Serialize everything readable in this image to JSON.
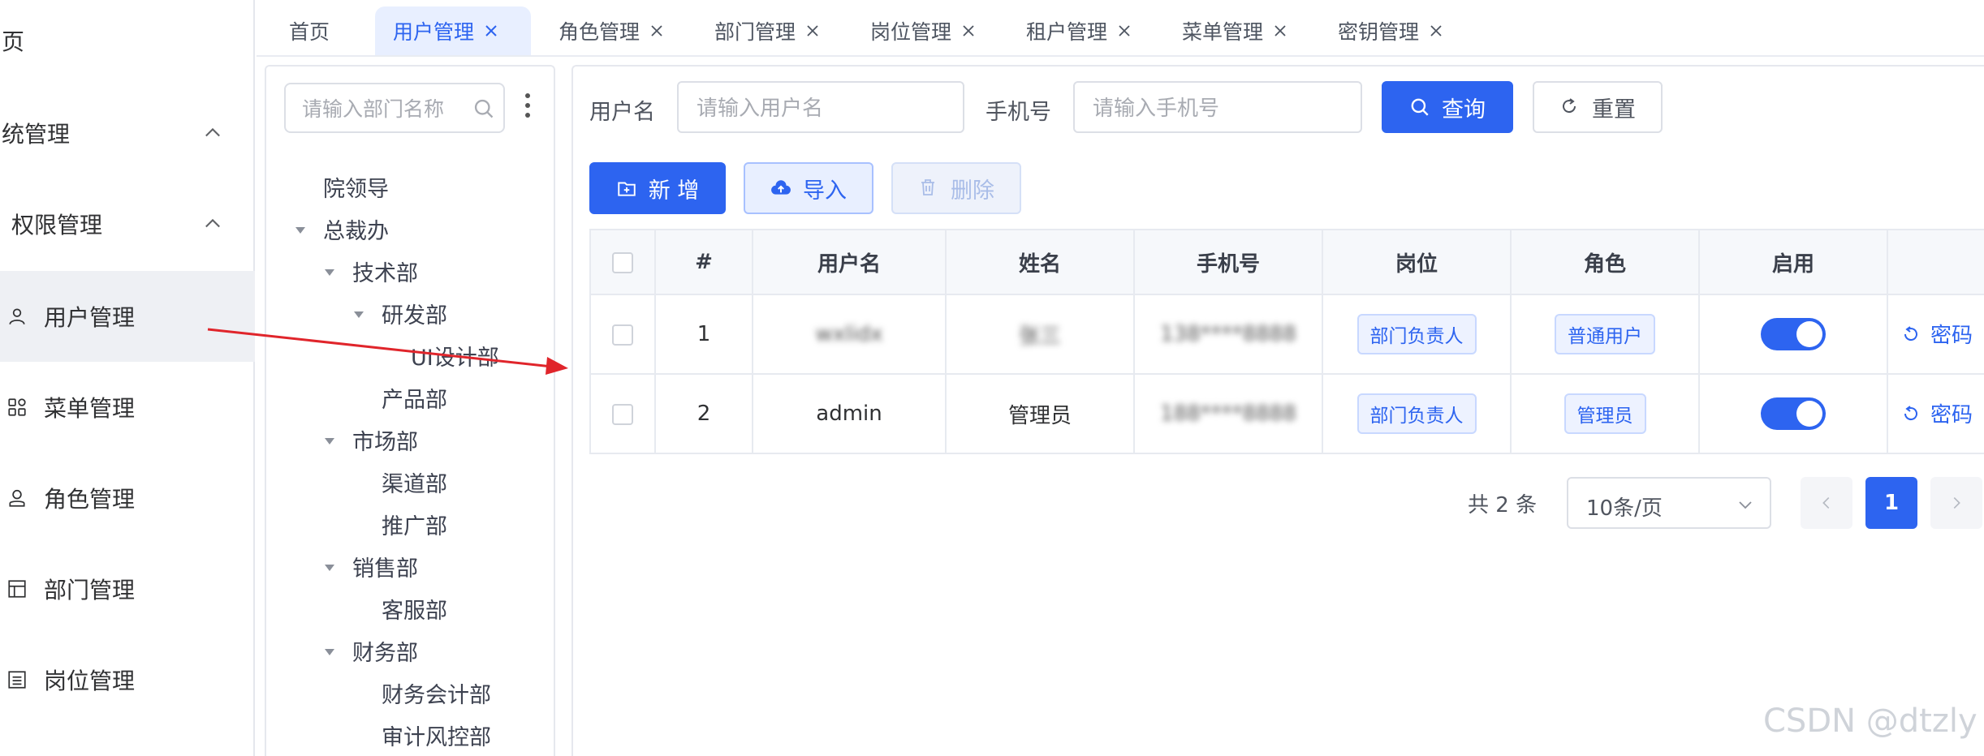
{
  "sidebar": {
    "items": [
      {
        "label": "页"
      },
      {
        "label": "统管理"
      },
      {
        "label": "权限管理"
      },
      {
        "label": "用户管理"
      },
      {
        "label": "菜单管理"
      },
      {
        "label": "角色管理"
      },
      {
        "label": "部门管理"
      },
      {
        "label": "岗位管理"
      }
    ]
  },
  "tabs": [
    {
      "label": "首页"
    },
    {
      "label": "用户管理"
    },
    {
      "label": "角色管理"
    },
    {
      "label": "部门管理"
    },
    {
      "label": "岗位管理"
    },
    {
      "label": "租户管理"
    },
    {
      "label": "菜单管理"
    },
    {
      "label": "密钥管理"
    }
  ],
  "dept": {
    "search_placeholder": "请输入部门名称",
    "tree": [
      "院领导",
      "总裁办",
      "技术部",
      "研发部",
      "UI设计部",
      "产品部",
      "市场部",
      "渠道部",
      "推广部",
      "销售部",
      "客服部",
      "财务部",
      "财务会计部",
      "审计风控部"
    ]
  },
  "filters": {
    "username_label": "用户名",
    "username_placeholder": "请输入用户名",
    "phone_label": "手机号",
    "phone_placeholder": "请输入手机号",
    "query_label": "查询",
    "reset_label": "重置"
  },
  "actions": {
    "add_label": "新 增",
    "import_label": "导入",
    "delete_label": "删除"
  },
  "table": {
    "headers": [
      "#",
      "用户名",
      "姓名",
      "手机号",
      "岗位",
      "角色",
      "启用"
    ],
    "rows": [
      {
        "index": "1",
        "username": "wxlidx",
        "name": "张三",
        "phone": "138****8888",
        "post": "部门负责人",
        "role": "普通用户",
        "op": "密码"
      },
      {
        "index": "2",
        "username": "admin",
        "name": "管理员",
        "phone": "188****8888",
        "post": "部门负责人",
        "role": "管理员",
        "op": "密码"
      }
    ]
  },
  "pagination": {
    "total": "共 2 条",
    "page_size": "10条/页",
    "current": "1"
  },
  "watermark": "CSDN @dtzly",
  "colors": {
    "primary": "#2d64f0",
    "annotation_arrow": "#e0252b"
  }
}
